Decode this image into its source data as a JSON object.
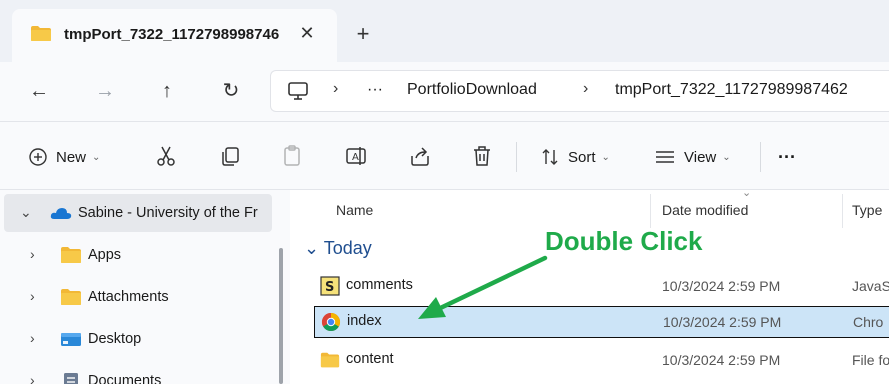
{
  "tab": {
    "title": "tmpPort_7322_1172798998746",
    "close_symbol": "✕",
    "new_tab_symbol": "+"
  },
  "nav": {
    "back": "←",
    "forward": "→",
    "up": "↑",
    "refresh": "↻"
  },
  "address": {
    "more": "···",
    "separator": "›",
    "crumbs": [
      "PortfolioDownload",
      "tmpPort_7322_11727989987462"
    ]
  },
  "toolbar": {
    "new_label": "New",
    "sort_label": "Sort",
    "view_label": "View",
    "more_label": "···",
    "caret": "⌄"
  },
  "sidebar": {
    "items": [
      {
        "label": "Sabine - University of the Fr",
        "chevron": "⌄"
      },
      {
        "label": "Apps",
        "chevron": "›"
      },
      {
        "label": "Attachments",
        "chevron": "›"
      },
      {
        "label": "Desktop",
        "chevron": "›"
      },
      {
        "label": "Documents",
        "chevron": "›"
      }
    ]
  },
  "columns": {
    "name": "Name",
    "date": "Date modified",
    "type": "Type",
    "sort_caret": "⌄"
  },
  "group": {
    "label": "⌄ Today"
  },
  "files": [
    {
      "name": "comments",
      "date": "10/3/2024 2:59 PM",
      "type": "JavaS"
    },
    {
      "name": "index",
      "date": "10/3/2024 2:59 PM",
      "type": "Chro"
    },
    {
      "name": "content",
      "date": "10/3/2024 2:59 PM",
      "type": "File fo"
    }
  ],
  "annotation": {
    "text": "Double Click",
    "color": "#1faa4a"
  },
  "colors": {
    "selection": "#cce4f7",
    "folder": "#f2b836",
    "onedrive": "#1976d2"
  }
}
